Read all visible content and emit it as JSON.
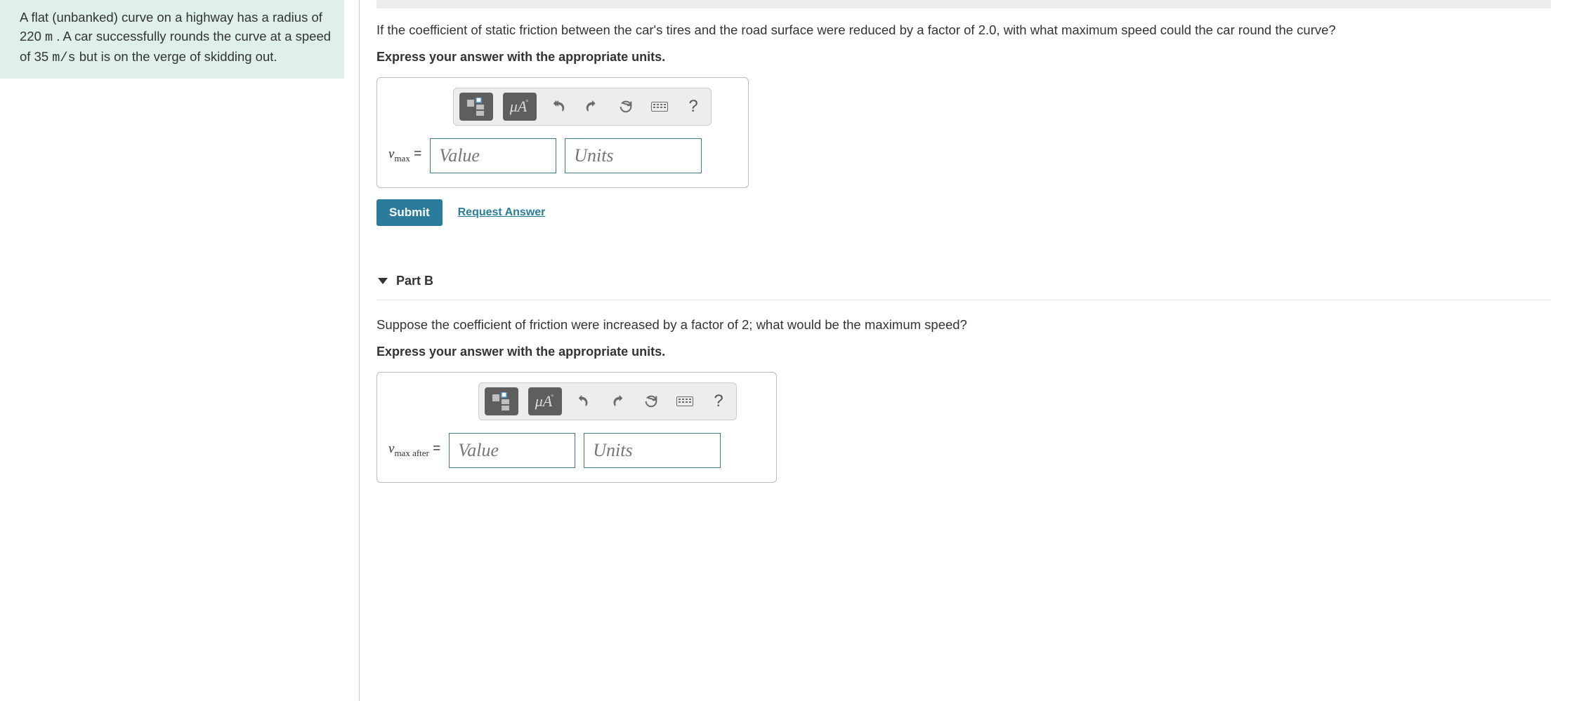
{
  "problem": {
    "text_parts": [
      "A flat (unbanked) curve on a highway has a radius of 220 ",
      "m",
      " . A car successfully rounds the curve at a speed of 35 ",
      "m/s",
      " but is on the verge of skidding out."
    ]
  },
  "partA": {
    "question": "If the coefficient of static friction between the car's tires and the road surface were reduced by a factor of 2.0, with what maximum speed could the car round the curve?",
    "instruction": "Express your answer with the appropriate units.",
    "variable_html": "v",
    "variable_sub": "max",
    "equals": " = ",
    "value_placeholder": "Value",
    "units_placeholder": "Units",
    "submit_label": "Submit",
    "request_label": "Request Answer",
    "toolbar": {
      "units_symbol": "μÅ",
      "help": "?"
    }
  },
  "partB": {
    "header": "Part B",
    "question": "Suppose the coefficient of friction were increased by a factor of 2; what would be the maximum speed?",
    "instruction": "Express your answer with the appropriate units.",
    "variable_html": "v",
    "variable_sub": "max after",
    "equals": " = ",
    "value_placeholder": "Value",
    "units_placeholder": "Units",
    "toolbar": {
      "units_symbol": "μÅ",
      "help": "?"
    }
  }
}
